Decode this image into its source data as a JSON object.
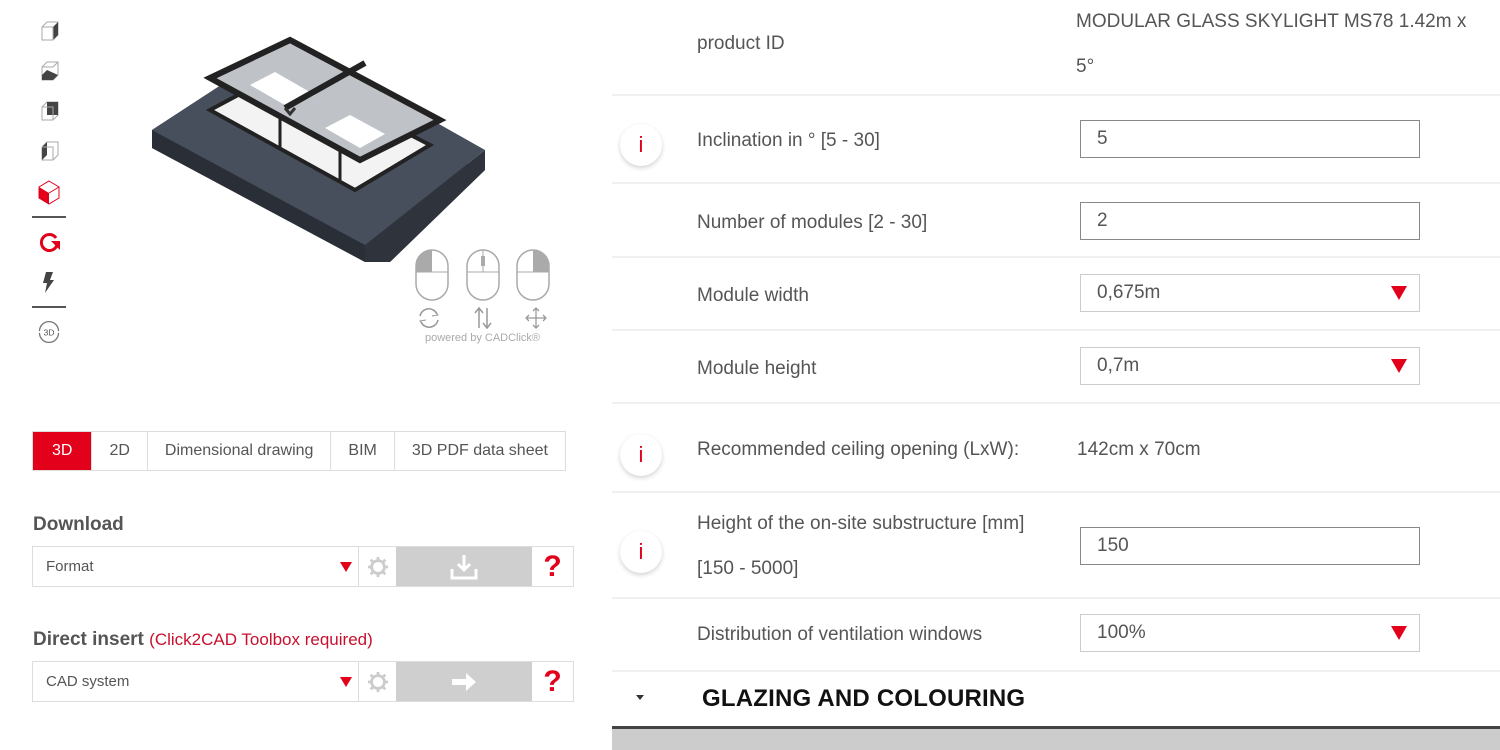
{
  "toolbar": {
    "tools": [
      {
        "icon": "view-right-icon"
      },
      {
        "icon": "view-bottom-icon"
      },
      {
        "icon": "view-back-icon"
      },
      {
        "icon": "view-left-icon"
      },
      {
        "icon": "view-iso-icon"
      },
      {
        "icon": "rotate-icon"
      },
      {
        "icon": "flash-icon"
      },
      {
        "icon": "rotate-3d-icon",
        "label": "3D"
      }
    ]
  },
  "viewer": {
    "mouse_help": {
      "buttons": [
        "left-click-rotate",
        "wheel-zoom",
        "right-click-pan"
      ],
      "powered_by": "powered by CADClick®"
    }
  },
  "tabs": [
    {
      "label": "3D",
      "active": true
    },
    {
      "label": "2D",
      "active": false
    },
    {
      "label": "Dimensional drawing",
      "active": false
    },
    {
      "label": "BIM",
      "active": false
    },
    {
      "label": "3D PDF data sheet",
      "active": false
    }
  ],
  "download": {
    "title": "Download",
    "select_value": "Format"
  },
  "direct_insert": {
    "title": "Direct insert",
    "note": "(Click2CAD Toolbox required)",
    "select_value": "CAD system"
  },
  "help_glyph": "?",
  "config": {
    "product_id": {
      "label": "product ID",
      "value_line1": "MODULAR GLASS SKYLIGHT MS78 1.42m x",
      "value_line2": "5°"
    },
    "inclination": {
      "label": "Inclination in ° [5 - 30]",
      "value": "5"
    },
    "modules": {
      "label": "Number of modules [2 - 30]",
      "value": "2"
    },
    "module_width": {
      "label": "Module width",
      "value": "0,675m"
    },
    "module_height": {
      "label": "Module height",
      "value": "0,7m"
    },
    "ceiling_opening": {
      "label": "Recommended ceiling opening (LxW):",
      "value": "142cm x 70cm"
    },
    "substructure": {
      "label_line1": "Height of the on-site substructure [mm]",
      "label_line2": "[150 - 5000]",
      "value": "150"
    },
    "ventilation": {
      "label": "Distribution of ventilation windows",
      "value": "100%"
    },
    "info_glyph": "i"
  },
  "glazing_section": {
    "title": "GLAZING AND COLOURING"
  },
  "colors": {
    "accent": "#e2001a",
    "text": "#555555"
  }
}
